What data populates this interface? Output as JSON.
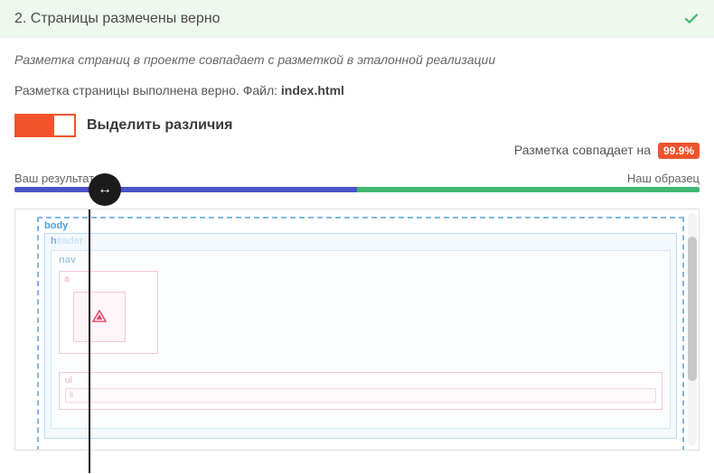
{
  "header": {
    "title": "2. Страницы размечены верно"
  },
  "note": "Разметка страниц в проекте совпадает с разметкой в эталонной реализации",
  "status_line": {
    "text": "Разметка страницы выполнена верно. ",
    "file_label": "Файл: ",
    "file_name": "index.html"
  },
  "toggle": {
    "label": "Выделить различия",
    "on": true
  },
  "match": {
    "text": "Разметка совпадает на",
    "percent": "99.9%"
  },
  "compare": {
    "left_label": "Ваш результат",
    "right_label": "Наш образец"
  },
  "preview": {
    "tags": {
      "body": "body",
      "header_prefix": "h",
      "header_suffix": "eader",
      "nav": "nav",
      "a": "a",
      "ul": "ul",
      "li": "li"
    }
  }
}
